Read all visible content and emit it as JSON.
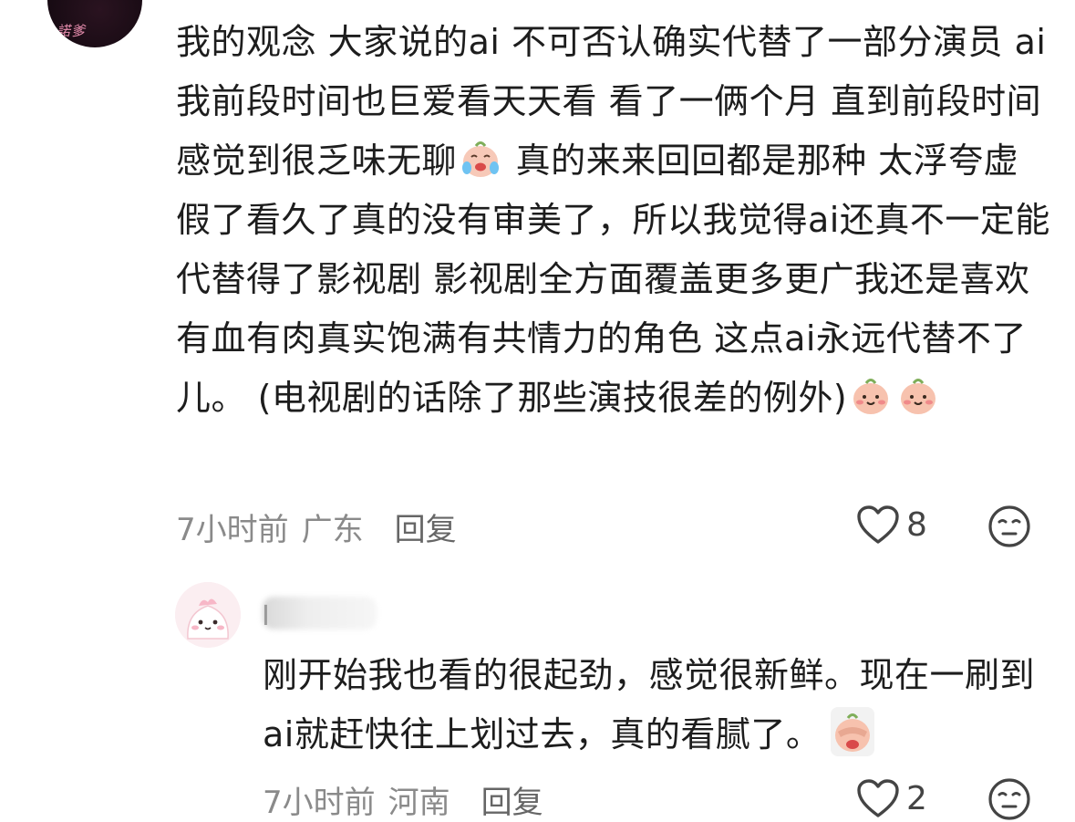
{
  "top_comment": {
    "avatar_text": "諾爹",
    "text_parts": {
      "p1": "我的观念 大家说的ai 不可否认确实代替了一部分演员 ai我前段时间也巨爱看天天看 看了一俩个月 直到前段时间感觉到很乏味无聊",
      "p2": " 真的来来回回都是那种 太浮夸虚假了看久了真的没有审美了，所以我觉得ai还真不一定能代替得了影视剧 影视剧全方面覆盖更多更广我还是喜欢有血有肉真实饱满有共情力的角色 这点ai永远代替不了儿。 (电视剧的话除了那些演技很差的例外)"
    },
    "emoji": {
      "crying": "crying-laugh-emoji",
      "smile": "smile-emoji"
    },
    "time": "7小时前",
    "location": "广东",
    "reply_label": "回复",
    "like_count": "8"
  },
  "reply_comment": {
    "username_visible": "I",
    "text": "刚开始我也看的很起劲，感觉很新鲜。现在一刷到ai就赶快往上划过去，真的看腻了。",
    "emoji": "facepalm-sticker",
    "time": "7小时前",
    "location": "河南",
    "reply_label": "回复",
    "like_count": "2"
  },
  "colors": {
    "text": "#1d1d1d",
    "meta": "#8a8a8a",
    "emoji_face": "#f7c9b8",
    "emoji_cheek": "#f08a8a"
  }
}
